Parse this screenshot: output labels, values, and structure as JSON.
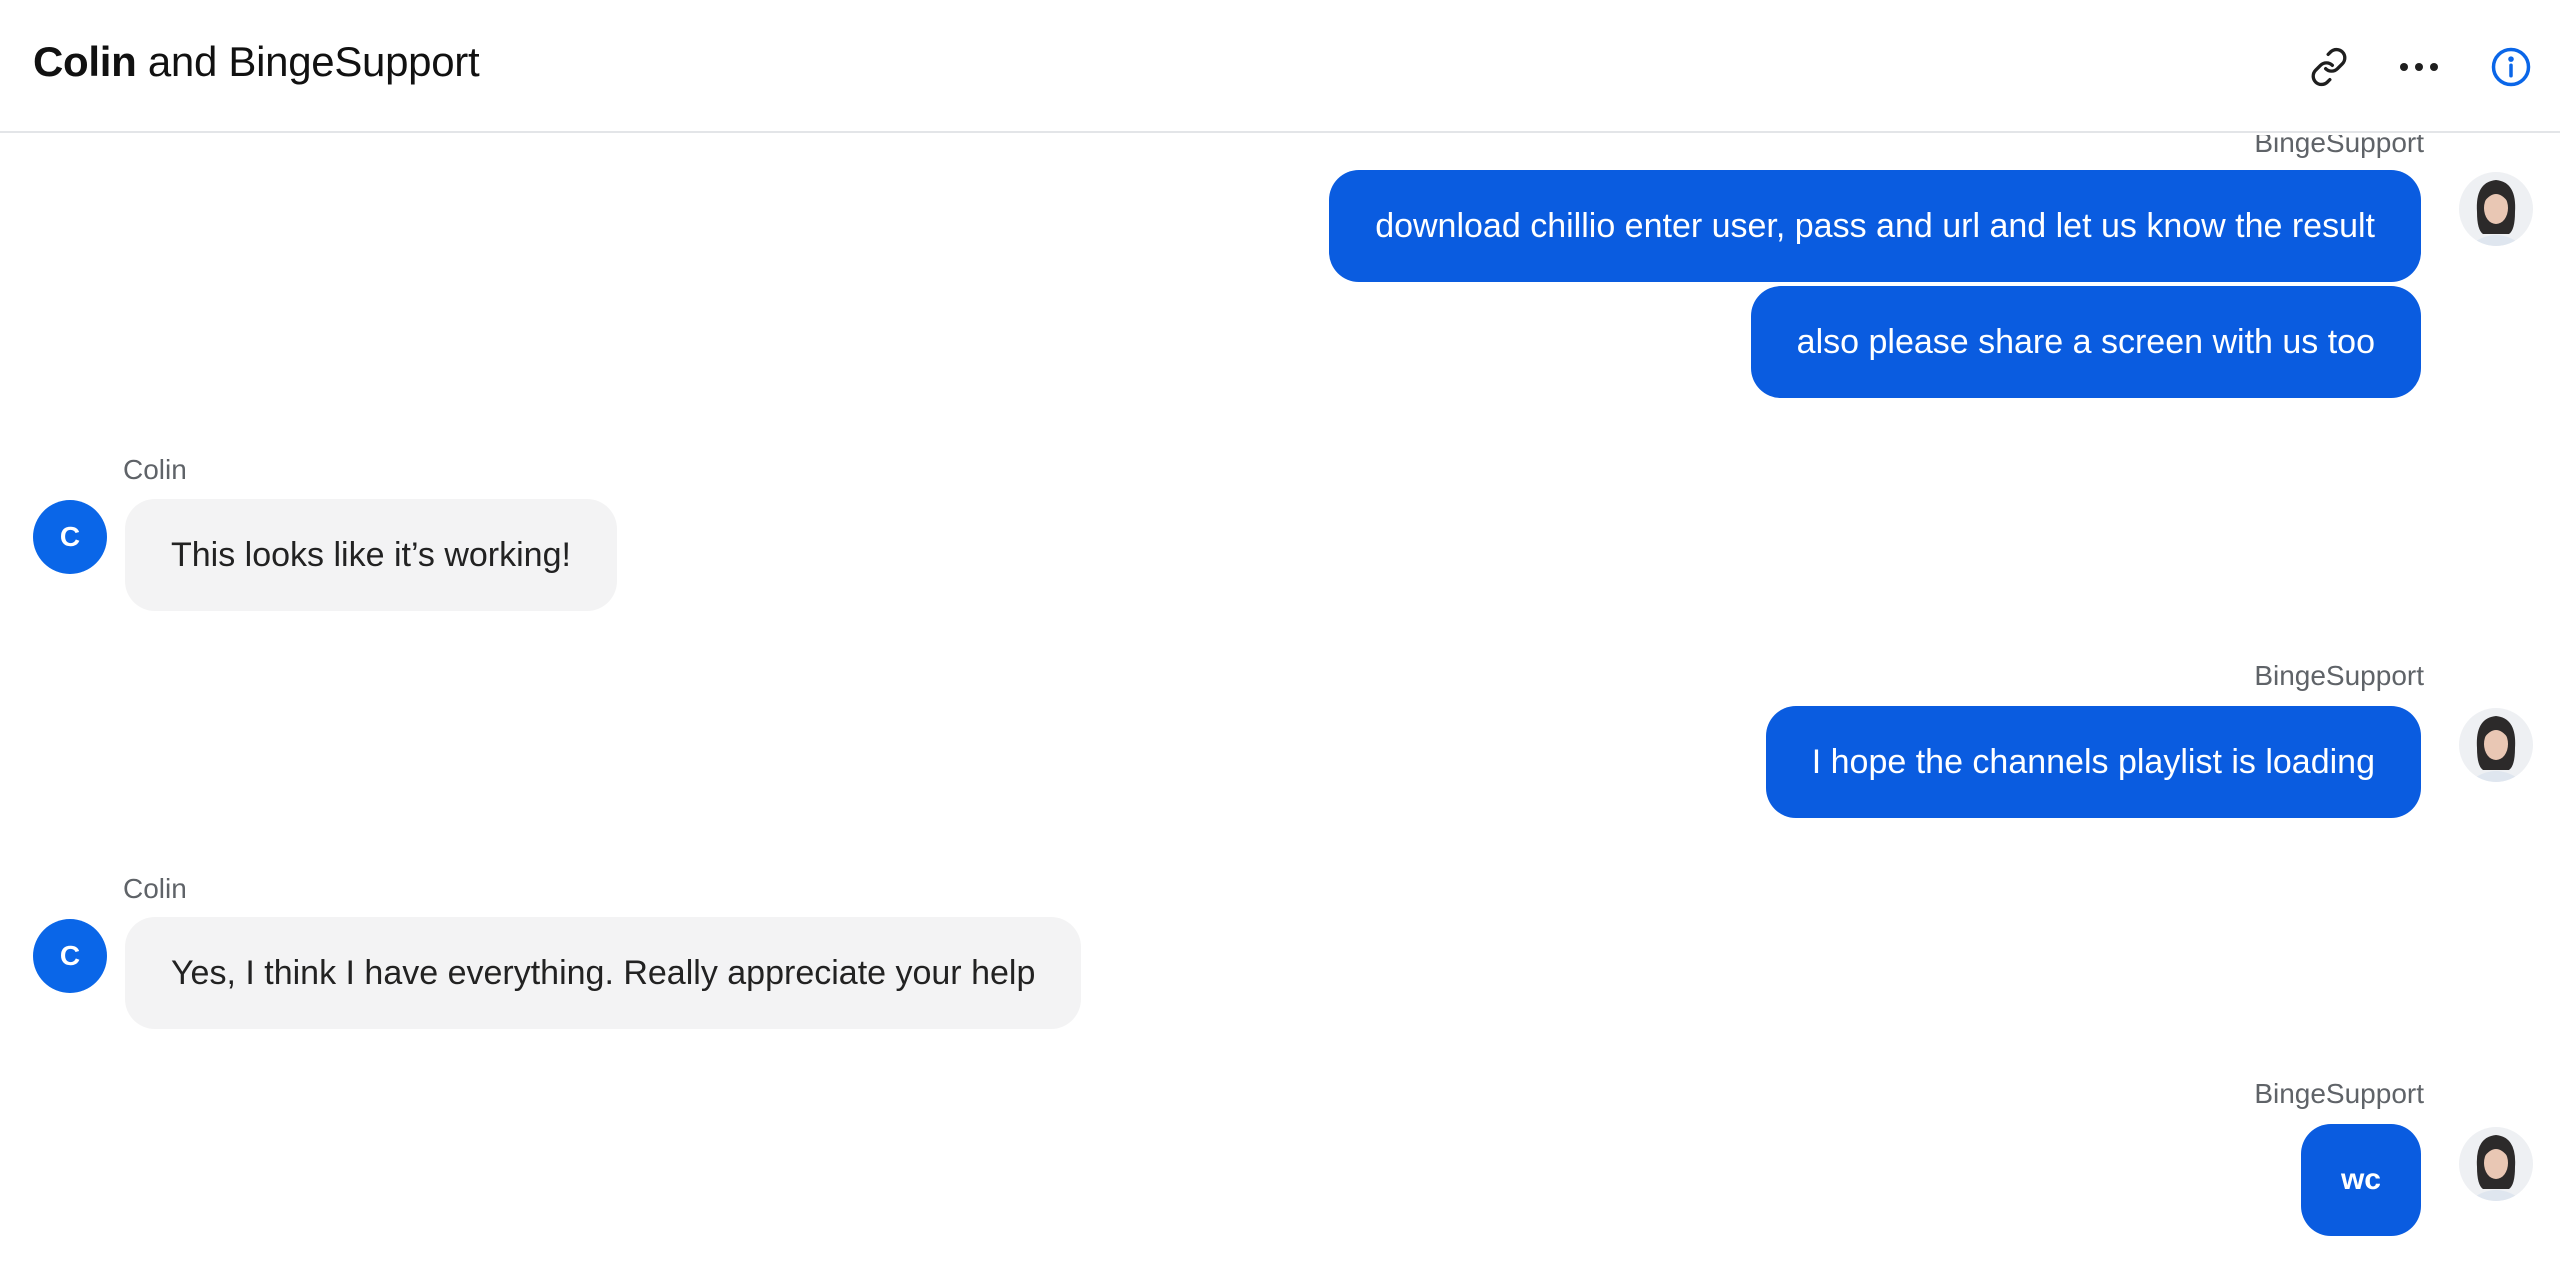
{
  "header": {
    "title_part1": "Colin",
    "title_part2": " and BingeSupport",
    "icons": [
      "link-icon",
      "more-icon",
      "info-icon"
    ]
  },
  "colors": {
    "accent": "#0a5ce0",
    "incoming_bubble": "#f3f3f4",
    "info_icon": "#0a66e8"
  },
  "messages": [
    {
      "from": "BingeSupport",
      "sender_label": "BingeSupport",
      "text": "download chillio enter user, pass and url and let us know the result"
    },
    {
      "from": "BingeSupport",
      "text": "also please share a screen with us too"
    },
    {
      "from": "Colin",
      "sender_label": "Colin",
      "avatar_initial": "C",
      "text": "This looks like it’s working!"
    },
    {
      "from": "BingeSupport",
      "sender_label": "BingeSupport",
      "text": "I hope the channels playlist is loading"
    },
    {
      "from": "Colin",
      "sender_label": "Colin",
      "avatar_initial": "C",
      "text": "Yes, I think I have everything. Really appreciate your help"
    },
    {
      "from": "BingeSupport",
      "sender_label": "BingeSupport",
      "text": "wc"
    }
  ]
}
